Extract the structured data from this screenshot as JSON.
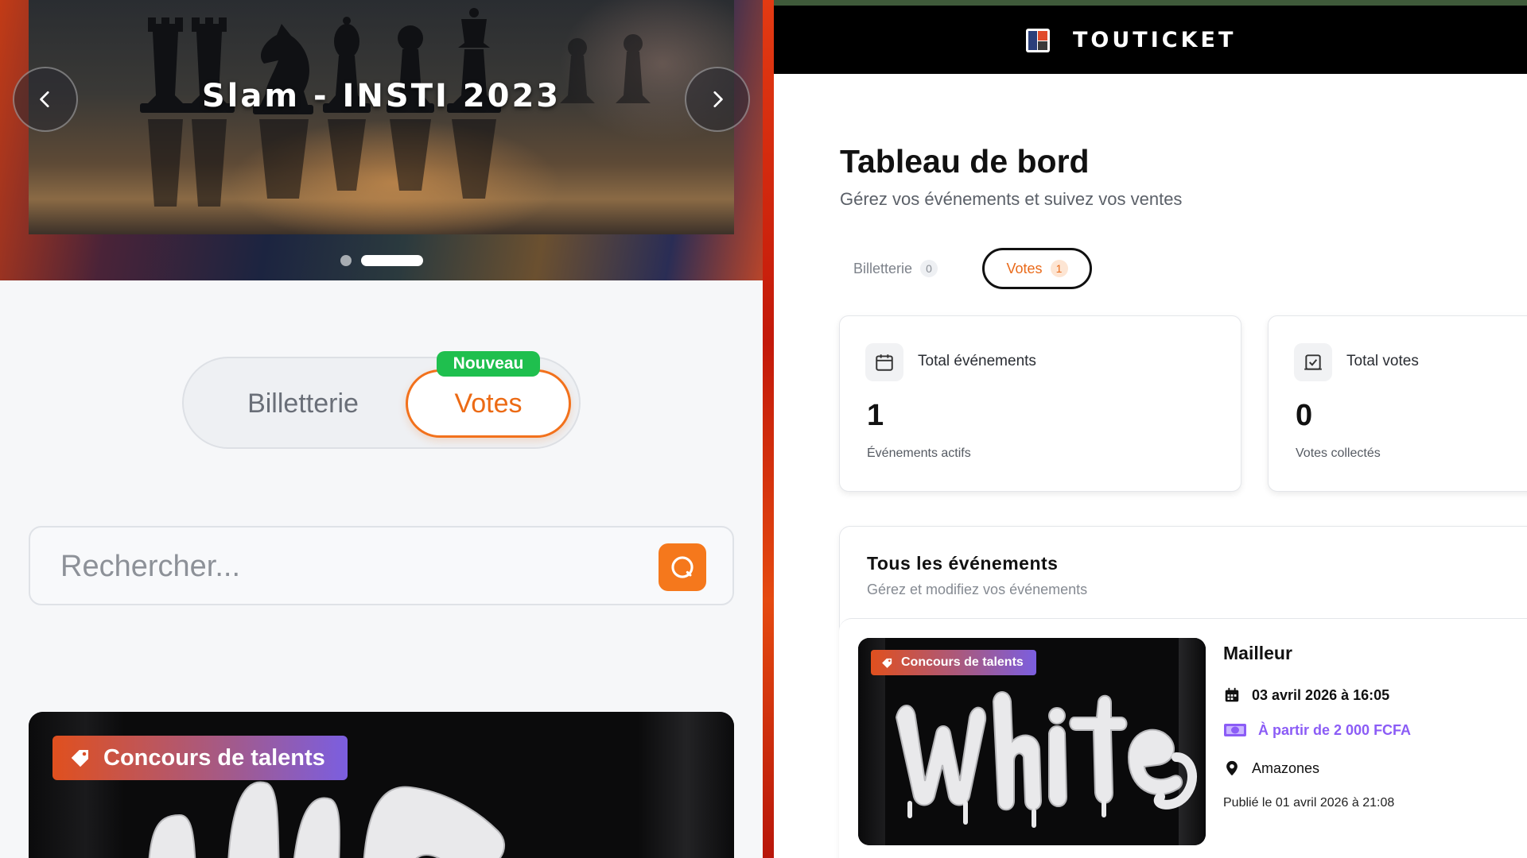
{
  "left": {
    "hero": {
      "title": "Slam - INSTI 2023",
      "prev_icon": "chevron-left-icon",
      "next_icon": "chevron-right-icon",
      "slide_count": 2,
      "active_slide": 2
    },
    "switch": {
      "billetterie": "Billetterie",
      "votes": "Votes",
      "new_badge": "Nouveau",
      "active": "votes"
    },
    "search": {
      "placeholder": "Rechercher...",
      "icon": "search-icon"
    },
    "card": {
      "category": "Concours de talents",
      "category_icon": "tag-icon"
    }
  },
  "right": {
    "brand": "TOUTICKET",
    "title": "Tableau de bord",
    "subtitle": "Gérez vos événements et suivez vos ventes",
    "tabs": [
      {
        "label": "Billetterie",
        "count": "0",
        "active": false
      },
      {
        "label": "Votes",
        "count": "1",
        "active": true
      }
    ],
    "stats": [
      {
        "label": "Total événements",
        "value": "1",
        "sub": "Événements actifs",
        "icon": "calendar-icon"
      },
      {
        "label": "Total votes",
        "value": "0",
        "sub": "Votes collectés",
        "icon": "checkbox-icon"
      }
    ],
    "events_section": {
      "title": "Tous les événements",
      "subtitle": "Gérez et modifiez vos événements"
    },
    "event": {
      "category": "Concours de talents",
      "name": "Mailleur",
      "date": "03 avril 2026 à 16:05",
      "price": "À partir de 2 000 FCFA",
      "location": "Amazones",
      "published": "Publié le 01 avril 2026 à 21:08"
    }
  },
  "colors": {
    "accent_orange": "#f2711c",
    "badge_green": "#1fbf4e",
    "price_purple": "#8b5cf6",
    "divider_red": "#c4200c"
  }
}
